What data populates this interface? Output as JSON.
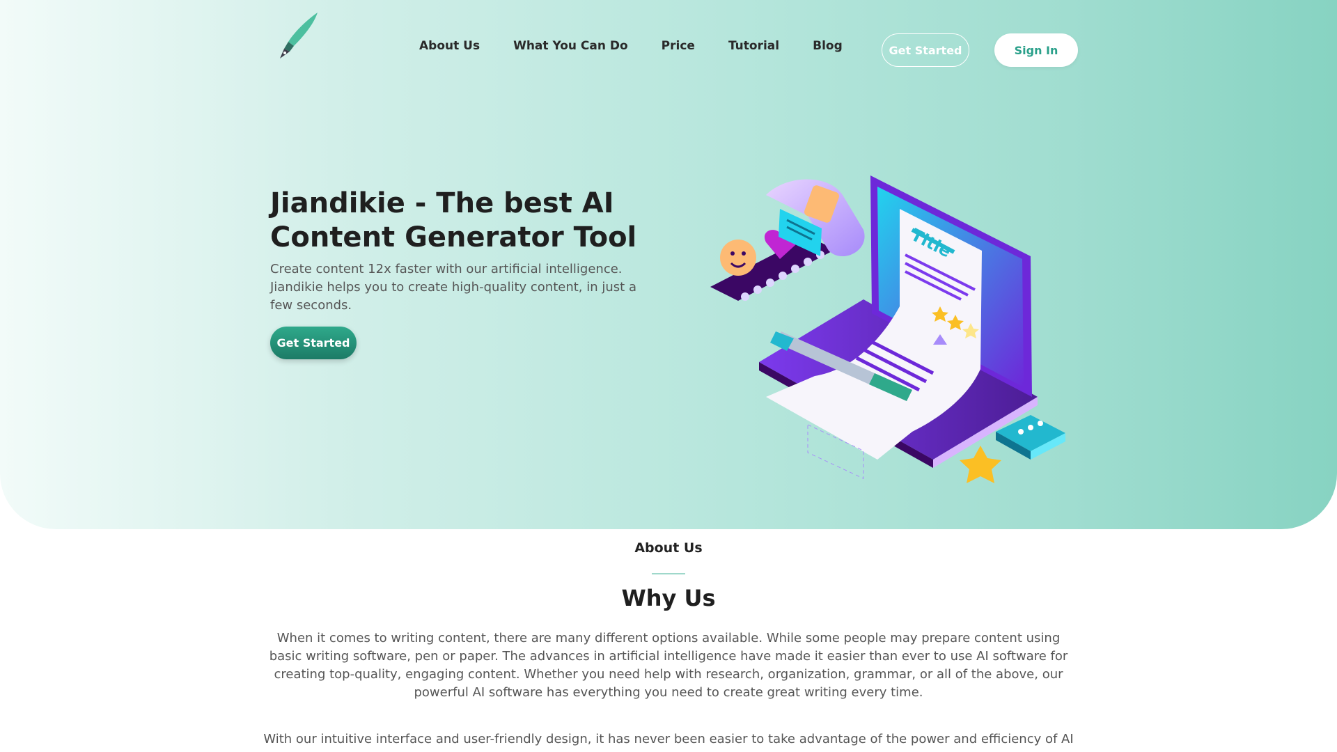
{
  "brand": {
    "logo_icon": "feather-pen-icon"
  },
  "nav": {
    "items": [
      {
        "label": "About Us"
      },
      {
        "label": "What You Can Do"
      },
      {
        "label": "Price"
      },
      {
        "label": "Tutorial"
      },
      {
        "label": "Blog"
      }
    ],
    "get_started_label": "Get Started",
    "sign_in_label": "Sign In"
  },
  "hero": {
    "title": "Jiandikie - The best AI Content Generator Tool",
    "subtitle": "Create content 12x faster with our artificial intelligence. Jiandikie helps you to create high-quality content, in just a few seconds.",
    "cta_label": "Get Started",
    "illustration_title_text": "Title"
  },
  "about": {
    "section_label": "About Us",
    "heading": "Why Us",
    "paragraph1": "When it comes to writing content, there are many different options available. While some people may prepare content using basic writing software, pen or paper. The advances in artificial intelligence have made it easier than ever to use AI software for creating top-quality, engaging content. Whether you need help with research, organization, grammar, or all of the above, our powerful AI software has everything you need to create great writing every time.",
    "paragraph2": "With our intuitive interface and user-friendly design, it has never been easier to take advantage of the power and efficiency of AI"
  },
  "colors": {
    "accent": "#2aa08a",
    "cta_dark": "#1c7b66",
    "hero_gradient_start": "#f2fbf9",
    "hero_gradient_end": "#87d3c2",
    "illustration_purple": "#5b21b6"
  }
}
